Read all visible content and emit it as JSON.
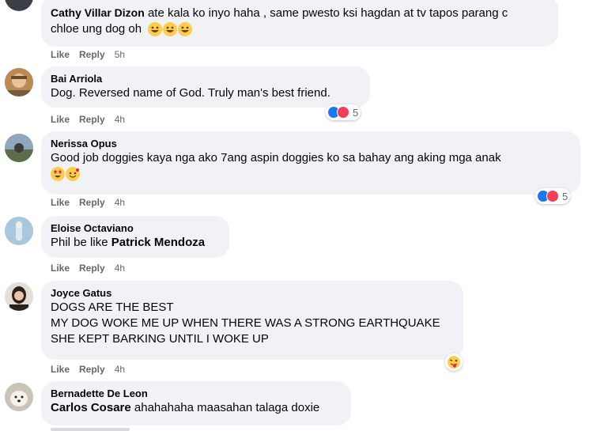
{
  "comments": [
    {
      "author": "Cathy Villar Dizon",
      "text_line1": "ate kala ko inyo haha , same pwesto ksi hagdan at tv tapos parang c",
      "text_line2": "chloe ung dog oh",
      "emoji": "grinning-face-with-smiling-eyes x3",
      "actions": {
        "like": "Like",
        "reply": "Reply",
        "time": "5h"
      }
    },
    {
      "author": "Bai Arriola",
      "text": "Dog. Reversed name of God. Truly man's best friend.",
      "actions": {
        "like": "Like",
        "reply": "Reply",
        "time": "4h"
      },
      "reactions": {
        "icons": [
          "like-icon",
          "love-icon"
        ],
        "count": "5"
      }
    },
    {
      "author": "Nerissa Opus",
      "text": "Good job doggies kaya nga ako 7ang aspin doggies ko sa bahay ang aking mga anak",
      "emoji": "heart-eyes, smiling-face-with-hearts",
      "actions": {
        "like": "Like",
        "reply": "Reply",
        "time": "4h"
      },
      "reactions": {
        "icons": [
          "like-icon",
          "love-icon"
        ],
        "count": "5"
      }
    },
    {
      "author": "Eloise Octaviano",
      "text_prefix": "Phil be like ",
      "tagged": "Patrick Mendoza",
      "actions": {
        "like": "Like",
        "reply": "Reply",
        "time": "4h"
      }
    },
    {
      "author": "Joyce Gatus",
      "lines": [
        "DOGS ARE THE BEST",
        "MY DOG WOKE ME UP WHEN THERE WAS A STRONG EARTHQUAKE",
        "SHE KEPT BARKING UNTIL I WOKE UP"
      ],
      "actions": {
        "like": "Like",
        "reply": "Reply",
        "time": "4h"
      },
      "reactions": {
        "icons": [
          "winking-tongue-icon"
        ]
      }
    },
    {
      "author": "Bernadette De Leon",
      "tagged": "Carlos Cosare",
      "text_suffix": " ahahahaha maasahan talaga doxie"
    }
  ],
  "colors": {
    "bubble": "#f0f2f5",
    "meta": "#65676b",
    "like": "#1877f2",
    "love": "#f33e58"
  }
}
